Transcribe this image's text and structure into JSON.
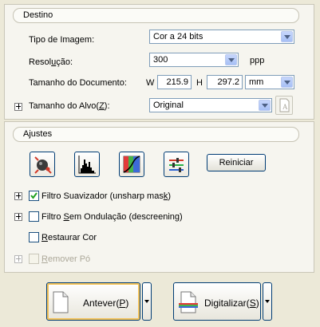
{
  "destino": {
    "header": "Destino",
    "image_type": {
      "label": "Tipo de Imagem:",
      "value": "Cor a 24 bits"
    },
    "resolution": {
      "label_pre": "Resol",
      "label_u": "u",
      "label_post": "ção:",
      "value": "300",
      "unit": "ppp"
    },
    "document_size": {
      "label": "Tamanho do Documento:",
      "w_label": "W",
      "w_value": "215.9",
      "h_label": "H",
      "h_value": "297.2",
      "unit": "mm"
    },
    "target_size": {
      "label_pre": "Tamanho do Alvo(",
      "label_u": "Z",
      "label_post": "):",
      "value": "Original"
    }
  },
  "ajustes": {
    "header": "Ajustes",
    "tools": [
      {
        "icon": "auto-exposure-icon"
      },
      {
        "icon": "histogram-icon"
      },
      {
        "icon": "tone-curve-icon"
      },
      {
        "icon": "color-balance-icon"
      }
    ],
    "reset_label": "Reiniciar",
    "options": [
      {
        "label_pre": "Filtro Suavizador (unsharp mas",
        "label_u": "k",
        "label_post": ")",
        "checked": true
      },
      {
        "label_pre": "Filtro ",
        "label_u": "S",
        "label_post": "em Ondulação (descreening)",
        "checked": false
      },
      {
        "label_pre": "",
        "label_u": "R",
        "label_post": "estaurar Cor",
        "checked": false
      },
      {
        "label_pre": "",
        "label_u": "R",
        "label_post": "emover Pó",
        "checked": false,
        "disabled": true
      }
    ]
  },
  "buttons": {
    "preview": {
      "label_pre": "Antever(",
      "label_u": "P",
      "label_post": ")"
    },
    "scan": {
      "label_pre": "Digitalizar(",
      "label_u": "S",
      "label_post": ")"
    }
  },
  "colors": {
    "window_bg": "#ece9d8",
    "border_blue": "#003c74",
    "check_green": "#21a121"
  }
}
